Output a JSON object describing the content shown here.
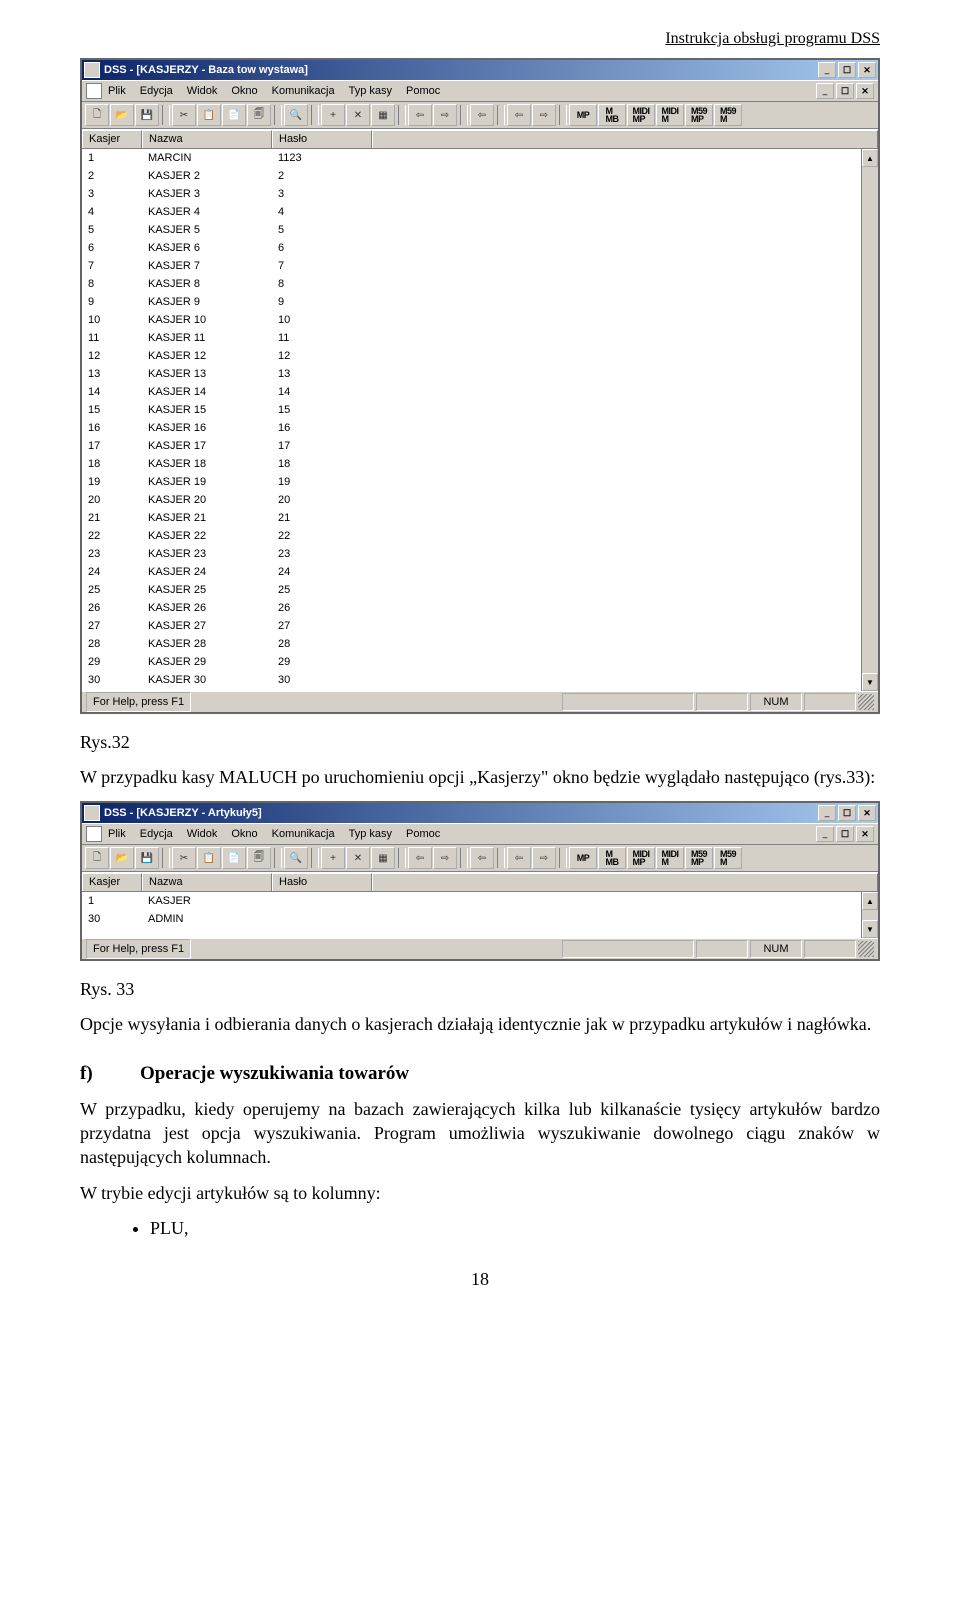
{
  "header": {
    "right_text": "Instrukcja obsługi programu DSS"
  },
  "win1": {
    "title": "DSS - [KASJERZY - Baza tow wystawa]",
    "winbtns": [
      "_",
      "☐",
      "✕"
    ],
    "menu_items": [
      "Plik",
      "Edycja",
      "Widok",
      "Okno",
      "Komunikacja",
      "Typ kasy",
      "Pomoc"
    ],
    "mdibtns": [
      "_",
      "☐",
      "✕"
    ],
    "toolbar_glyphs": [
      "🗋",
      "📂",
      "💾",
      "",
      "✂",
      "📋",
      "📄",
      "🗐",
      "",
      "🔍",
      "",
      "+",
      "✕",
      "▦",
      "",
      "⇦",
      "⇨",
      "",
      "⇦",
      "",
      "⇦",
      "⇨",
      ""
    ],
    "toolbar_text": [
      "MP",
      "M\nMB",
      "MIDI\nMP",
      "MIDI\nM",
      "M59\nMP",
      "M59\nM"
    ],
    "columns": [
      "Kasjer",
      "Nazwa",
      "Hasło"
    ],
    "rows": [
      {
        "k": "1",
        "n": "MARCIN",
        "h": "1123"
      },
      {
        "k": "2",
        "n": "KASJER  2",
        "h": "2"
      },
      {
        "k": "3",
        "n": "KASJER  3",
        "h": "3"
      },
      {
        "k": "4",
        "n": "KASJER  4",
        "h": "4"
      },
      {
        "k": "5",
        "n": "KASJER  5",
        "h": "5"
      },
      {
        "k": "6",
        "n": "KASJER  6",
        "h": "6"
      },
      {
        "k": "7",
        "n": "KASJER  7",
        "h": "7"
      },
      {
        "k": "8",
        "n": "KASJER  8",
        "h": "8"
      },
      {
        "k": "9",
        "n": "KASJER  9",
        "h": "9"
      },
      {
        "k": "10",
        "n": "KASJER  10",
        "h": "10"
      },
      {
        "k": "11",
        "n": "KASJER  11",
        "h": "11"
      },
      {
        "k": "12",
        "n": "KASJER  12",
        "h": "12"
      },
      {
        "k": "13",
        "n": "KASJER  13",
        "h": "13"
      },
      {
        "k": "14",
        "n": "KASJER  14",
        "h": "14"
      },
      {
        "k": "15",
        "n": "KASJER  15",
        "h": "15"
      },
      {
        "k": "16",
        "n": "KASJER  16",
        "h": "16"
      },
      {
        "k": "17",
        "n": "KASJER  17",
        "h": "17"
      },
      {
        "k": "18",
        "n": "KASJER  18",
        "h": "18"
      },
      {
        "k": "19",
        "n": "KASJER  19",
        "h": "19"
      },
      {
        "k": "20",
        "n": "KASJER  20",
        "h": "20"
      },
      {
        "k": "21",
        "n": "KASJER  21",
        "h": "21"
      },
      {
        "k": "22",
        "n": "KASJER  22",
        "h": "22"
      },
      {
        "k": "23",
        "n": "KASJER  23",
        "h": "23"
      },
      {
        "k": "24",
        "n": "KASJER  24",
        "h": "24"
      },
      {
        "k": "25",
        "n": "KASJER  25",
        "h": "25"
      },
      {
        "k": "26",
        "n": "KASJER  26",
        "h": "26"
      },
      {
        "k": "27",
        "n": "KASJER  27",
        "h": "27"
      },
      {
        "k": "28",
        "n": "KASJER  28",
        "h": "28"
      },
      {
        "k": "29",
        "n": "KASJER  29",
        "h": "29"
      },
      {
        "k": "30",
        "n": "KASJER  30",
        "h": "30"
      }
    ],
    "status_left": "For Help, press F1",
    "status_num": "NUM"
  },
  "caption1": "Rys.32",
  "para1": "W przypadku kasy MALUCH po uruchomieniu opcji „Kasjerzy\" okno będzie wyglądało następująco (rys.33):",
  "win2": {
    "title": "DSS - [KASJERZY - Artykuły5]",
    "winbtns": [
      "_",
      "☐",
      "✕"
    ],
    "menu_items": [
      "Plik",
      "Edycja",
      "Widok",
      "Okno",
      "Komunikacja",
      "Typ kasy",
      "Pomoc"
    ],
    "mdibtns": [
      "_",
      "☐",
      "✕"
    ],
    "toolbar_glyphs": [
      "🗋",
      "📂",
      "💾",
      "",
      "✂",
      "📋",
      "📄",
      "🗐",
      "",
      "🔍",
      "",
      "+",
      "✕",
      "▦",
      "",
      "⇦",
      "⇨",
      "",
      "⇦",
      "",
      "⇦",
      "⇨",
      ""
    ],
    "toolbar_text": [
      "MP",
      "M\nMB",
      "MIDI\nMP",
      "MIDI\nM",
      "M59\nMP",
      "M59\nM"
    ],
    "columns": [
      "Kasjer",
      "Nazwa",
      "Hasło"
    ],
    "rows": [
      {
        "k": "1",
        "n": "KASJER",
        "h": ""
      },
      {
        "k": "30",
        "n": "ADMIN",
        "h": ""
      }
    ],
    "status_left": "For Help, press F1",
    "status_num": "NUM"
  },
  "caption2": "Rys. 33",
  "para2": "Opcje wysyłania i odbierania danych o kasjerach działają identycznie jak w przypadku artykułów i nagłówka.",
  "section_f": {
    "letter": "f)",
    "title": "Operacje wyszukiwania towarów"
  },
  "para3": "W przypadku, kiedy operujemy na bazach zawierających kilka lub kilkanaście tysięcy artykułów bardzo przydatna jest opcja wyszukiwania. Program umożliwia wyszukiwanie dowolnego ciągu znaków w następujących kolumnach.",
  "para4": "W trybie edycji artykułów są to kolumny:",
  "bullets": [
    "PLU,"
  ],
  "pagenum": "18"
}
